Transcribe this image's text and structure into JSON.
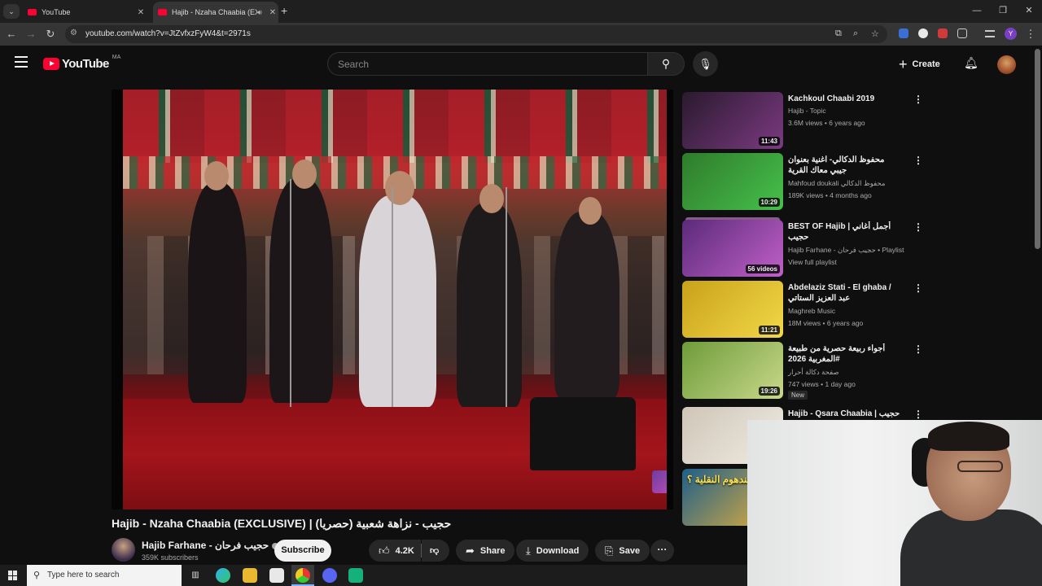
{
  "browser": {
    "tabs": [
      {
        "title": "YouTube",
        "active": false
      },
      {
        "title": "Hajib - Nzaha Chaabia (EXCL",
        "active": true
      }
    ],
    "url": "youtube.com/watch?v=JtZvfxzFyW4&t=2971s",
    "profile_initial": "Y"
  },
  "header": {
    "logo_text": "YouTube",
    "country_code": "MA",
    "search_placeholder": "Search",
    "create_label": "Create"
  },
  "video": {
    "title": "Hajib - Nzaha Chaabia (EXCLUSIVE) | حجيب - نزاهة شعبية (حصريا)",
    "channel": "Hajib Farhane - حجيب فرحان",
    "subscribers": "359K subscribers",
    "subscribe_label": "Subscribe",
    "likes": "4.2K",
    "share_label": "Share",
    "download_label": "Download",
    "save_label": "Save"
  },
  "recommendations": [
    {
      "title": "Kachkoul Chaabi 2019",
      "channel": "Hajib - Topic",
      "meta": "3.6M views • 6 years ago",
      "duration": "11:43",
      "thumb_colors": [
        "#2a1a2e",
        "#7b3a82"
      ]
    },
    {
      "title": "محفوظ الدكالي- اغنية بعنوان جيبي معاك القرية",
      "channel": "Mahfoud doukali محفوظ الدكالي",
      "meta": "189K views • 4 months ago",
      "duration": "10:29",
      "thumb_colors": [
        "#2f7b2c",
        "#46c04a"
      ]
    },
    {
      "title": "BEST OF Hajib | أجمل أغاني حجيب",
      "channel": "Hajib Farhane - حجيب فرحان • Playlist",
      "meta": "View full playlist",
      "duration": "56 videos",
      "thumb_colors": [
        "#5b2a7a",
        "#c060c8"
      ]
    },
    {
      "title": "Abdelaziz Stati - El ghaba / عبد العزيز الستاتي",
      "channel": "Maghreb Music",
      "meta": "18M views • 6 years ago",
      "duration": "11:21",
      "thumb_colors": [
        "#c9a21a",
        "#f2d848"
      ]
    },
    {
      "title": "أجواء ربيعة حصرية من طبيعة المغربية 2026#",
      "channel": "صفحة دكالة أحرار",
      "meta": "747 views • 1 day ago",
      "duration": "19:26",
      "badge": "New",
      "thumb_colors": [
        "#6e9c3a",
        "#c9d88a"
      ]
    },
    {
      "title": "Hajib - Qsara Chaabia | حجيب",
      "channel": "",
      "meta": "",
      "duration": "",
      "thumb_colors": [
        "#cfc6b8",
        "#f0ebe2"
      ]
    },
    {
      "title": "",
      "channel": "",
      "meta": "",
      "duration": "",
      "overlay_text": "عندهوم النقلية ؟",
      "thumb_colors": [
        "#1f5f8a",
        "#e8b23a"
      ]
    }
  ],
  "taskbar": {
    "search_placeholder": "Type here to search"
  }
}
